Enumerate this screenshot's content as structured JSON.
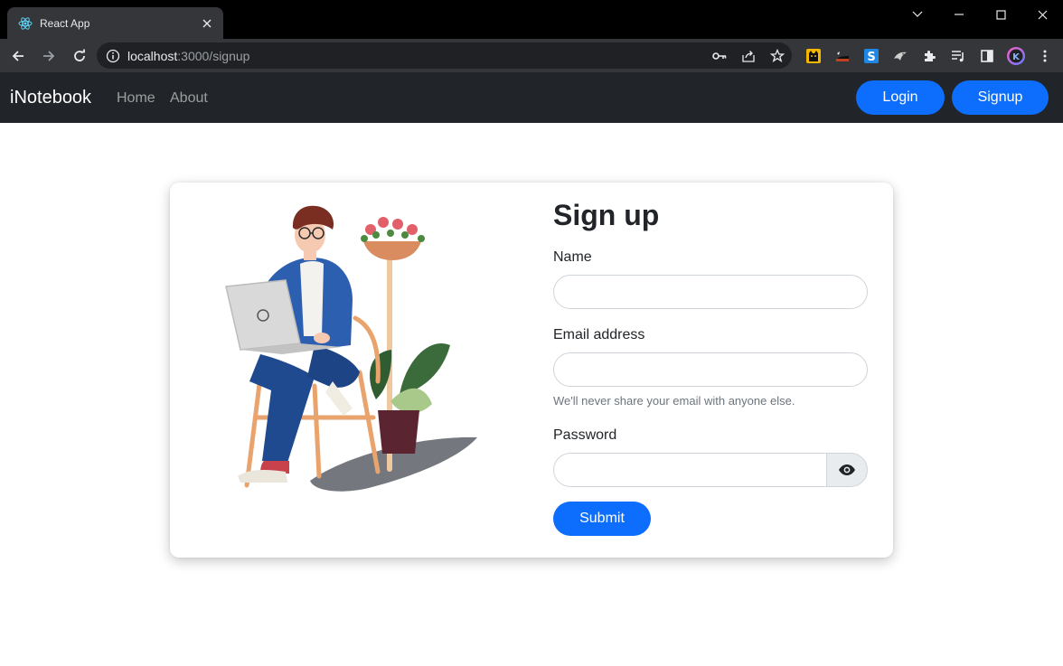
{
  "browser": {
    "tab_title": "React App",
    "url_host": "localhost",
    "url_path": ":3000/signup"
  },
  "navbar": {
    "brand": "iNotebook",
    "links": [
      "Home",
      "About"
    ],
    "login_label": "Login",
    "signup_label": "Signup"
  },
  "form": {
    "title": "Sign up",
    "name_label": "Name",
    "email_label": "Email address",
    "email_help": "We'll never share your email with anyone else.",
    "password_label": "Password",
    "submit_label": "Submit"
  },
  "colors": {
    "primary": "#0d6efd",
    "navbar_bg": "#212529",
    "browser_chrome": "#35363a"
  }
}
